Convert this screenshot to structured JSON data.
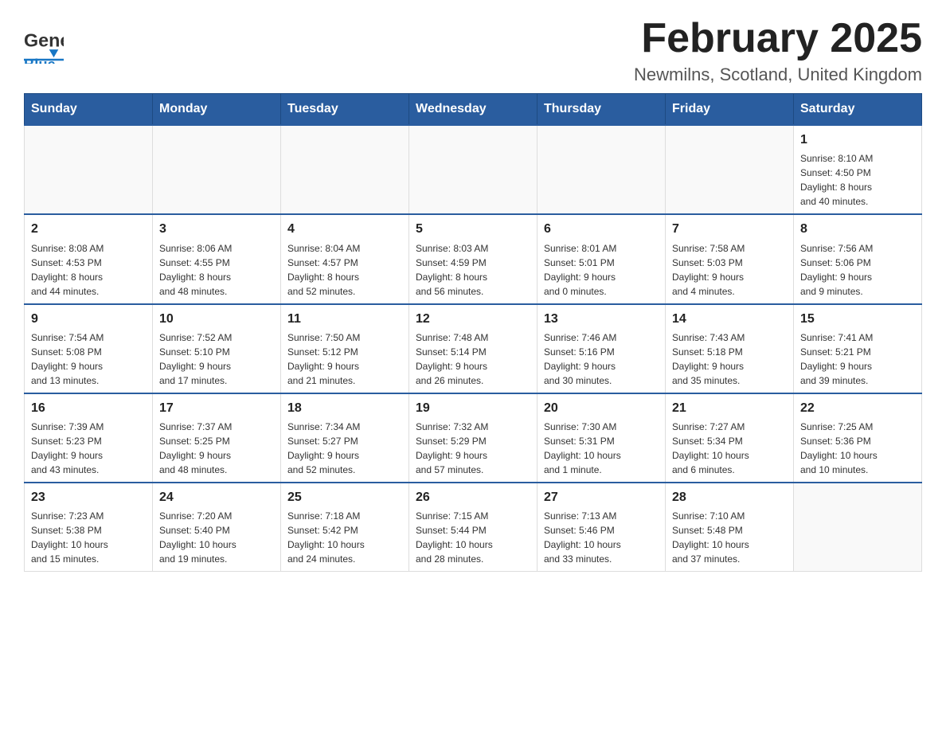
{
  "header": {
    "title": "February 2025",
    "subtitle": "Newmilns, Scotland, United Kingdom",
    "logo_general": "General",
    "logo_blue": "Blue"
  },
  "weekdays": [
    "Sunday",
    "Monday",
    "Tuesday",
    "Wednesday",
    "Thursday",
    "Friday",
    "Saturday"
  ],
  "weeks": [
    [
      {
        "day": "",
        "info": ""
      },
      {
        "day": "",
        "info": ""
      },
      {
        "day": "",
        "info": ""
      },
      {
        "day": "",
        "info": ""
      },
      {
        "day": "",
        "info": ""
      },
      {
        "day": "",
        "info": ""
      },
      {
        "day": "1",
        "info": "Sunrise: 8:10 AM\nSunset: 4:50 PM\nDaylight: 8 hours\nand 40 minutes."
      }
    ],
    [
      {
        "day": "2",
        "info": "Sunrise: 8:08 AM\nSunset: 4:53 PM\nDaylight: 8 hours\nand 44 minutes."
      },
      {
        "day": "3",
        "info": "Sunrise: 8:06 AM\nSunset: 4:55 PM\nDaylight: 8 hours\nand 48 minutes."
      },
      {
        "day": "4",
        "info": "Sunrise: 8:04 AM\nSunset: 4:57 PM\nDaylight: 8 hours\nand 52 minutes."
      },
      {
        "day": "5",
        "info": "Sunrise: 8:03 AM\nSunset: 4:59 PM\nDaylight: 8 hours\nand 56 minutes."
      },
      {
        "day": "6",
        "info": "Sunrise: 8:01 AM\nSunset: 5:01 PM\nDaylight: 9 hours\nand 0 minutes."
      },
      {
        "day": "7",
        "info": "Sunrise: 7:58 AM\nSunset: 5:03 PM\nDaylight: 9 hours\nand 4 minutes."
      },
      {
        "day": "8",
        "info": "Sunrise: 7:56 AM\nSunset: 5:06 PM\nDaylight: 9 hours\nand 9 minutes."
      }
    ],
    [
      {
        "day": "9",
        "info": "Sunrise: 7:54 AM\nSunset: 5:08 PM\nDaylight: 9 hours\nand 13 minutes."
      },
      {
        "day": "10",
        "info": "Sunrise: 7:52 AM\nSunset: 5:10 PM\nDaylight: 9 hours\nand 17 minutes."
      },
      {
        "day": "11",
        "info": "Sunrise: 7:50 AM\nSunset: 5:12 PM\nDaylight: 9 hours\nand 21 minutes."
      },
      {
        "day": "12",
        "info": "Sunrise: 7:48 AM\nSunset: 5:14 PM\nDaylight: 9 hours\nand 26 minutes."
      },
      {
        "day": "13",
        "info": "Sunrise: 7:46 AM\nSunset: 5:16 PM\nDaylight: 9 hours\nand 30 minutes."
      },
      {
        "day": "14",
        "info": "Sunrise: 7:43 AM\nSunset: 5:18 PM\nDaylight: 9 hours\nand 35 minutes."
      },
      {
        "day": "15",
        "info": "Sunrise: 7:41 AM\nSunset: 5:21 PM\nDaylight: 9 hours\nand 39 minutes."
      }
    ],
    [
      {
        "day": "16",
        "info": "Sunrise: 7:39 AM\nSunset: 5:23 PM\nDaylight: 9 hours\nand 43 minutes."
      },
      {
        "day": "17",
        "info": "Sunrise: 7:37 AM\nSunset: 5:25 PM\nDaylight: 9 hours\nand 48 minutes."
      },
      {
        "day": "18",
        "info": "Sunrise: 7:34 AM\nSunset: 5:27 PM\nDaylight: 9 hours\nand 52 minutes."
      },
      {
        "day": "19",
        "info": "Sunrise: 7:32 AM\nSunset: 5:29 PM\nDaylight: 9 hours\nand 57 minutes."
      },
      {
        "day": "20",
        "info": "Sunrise: 7:30 AM\nSunset: 5:31 PM\nDaylight: 10 hours\nand 1 minute."
      },
      {
        "day": "21",
        "info": "Sunrise: 7:27 AM\nSunset: 5:34 PM\nDaylight: 10 hours\nand 6 minutes."
      },
      {
        "day": "22",
        "info": "Sunrise: 7:25 AM\nSunset: 5:36 PM\nDaylight: 10 hours\nand 10 minutes."
      }
    ],
    [
      {
        "day": "23",
        "info": "Sunrise: 7:23 AM\nSunset: 5:38 PM\nDaylight: 10 hours\nand 15 minutes."
      },
      {
        "day": "24",
        "info": "Sunrise: 7:20 AM\nSunset: 5:40 PM\nDaylight: 10 hours\nand 19 minutes."
      },
      {
        "day": "25",
        "info": "Sunrise: 7:18 AM\nSunset: 5:42 PM\nDaylight: 10 hours\nand 24 minutes."
      },
      {
        "day": "26",
        "info": "Sunrise: 7:15 AM\nSunset: 5:44 PM\nDaylight: 10 hours\nand 28 minutes."
      },
      {
        "day": "27",
        "info": "Sunrise: 7:13 AM\nSunset: 5:46 PM\nDaylight: 10 hours\nand 33 minutes."
      },
      {
        "day": "28",
        "info": "Sunrise: 7:10 AM\nSunset: 5:48 PM\nDaylight: 10 hours\nand 37 minutes."
      },
      {
        "day": "",
        "info": ""
      }
    ]
  ]
}
